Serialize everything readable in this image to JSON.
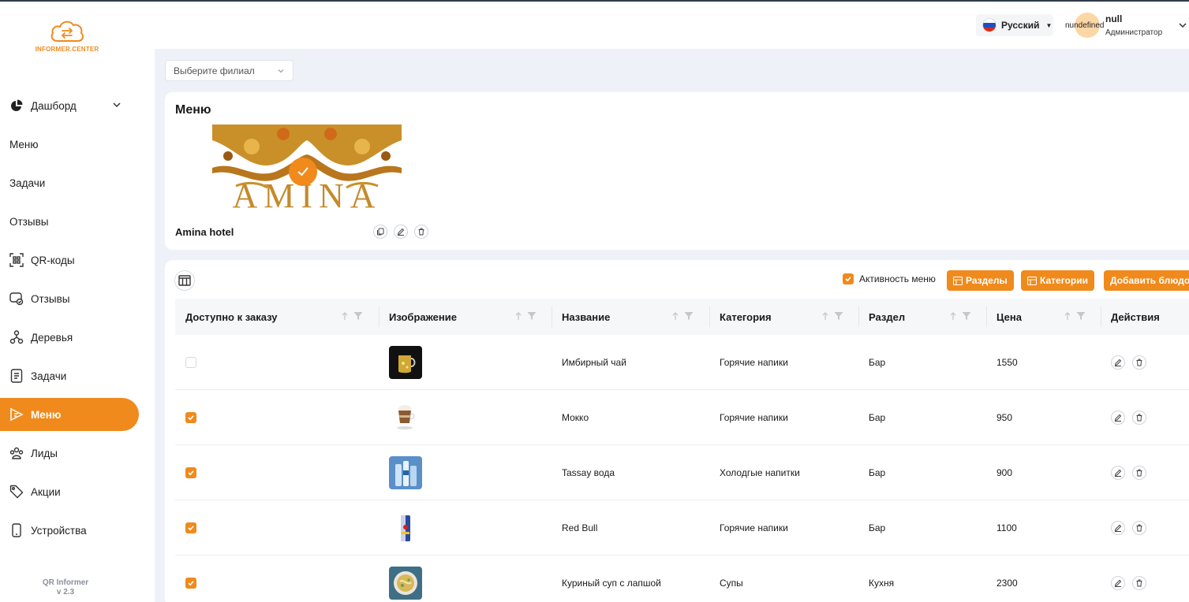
{
  "brand": {
    "logo_text": "INFORMER.CENTER",
    "app_name": "QR Informer",
    "version": "v 2.3",
    "accent": "#f08a1c"
  },
  "sidebar": {
    "items": [
      {
        "label": "Дашборд",
        "icon": "pie-chart-icon",
        "expandable": true
      },
      {
        "label": "Меню",
        "icon": ""
      },
      {
        "label": "Задачи",
        "icon": ""
      },
      {
        "label": "Отзывы",
        "icon": ""
      },
      {
        "label": "QR-коды",
        "icon": "qr-scan-icon"
      },
      {
        "label": "Отзывы",
        "icon": "feedback-icon"
      },
      {
        "label": "Деревья",
        "icon": "tree-icon"
      },
      {
        "label": "Задачи",
        "icon": "tasks-icon"
      },
      {
        "label": "Меню",
        "icon": "menu-icon",
        "active": true
      },
      {
        "label": "Лиды",
        "icon": "leads-icon"
      },
      {
        "label": "Акции",
        "icon": "tag-icon"
      },
      {
        "label": "Устройства",
        "icon": "device-icon"
      }
    ]
  },
  "header": {
    "language": "Русский",
    "user": {
      "avatar_text": "nundefined",
      "name": "null",
      "role": "Администратор"
    }
  },
  "branch_select": {
    "placeholder": "Выберите филиал"
  },
  "menu_card": {
    "title": "Меню",
    "image_text": "AMINA",
    "item_name": "Amina hotel"
  },
  "table_toolbar": {
    "activity_label": "Активность меню",
    "activity_checked": true,
    "sections_button": "Разделы",
    "categories_button": "Категории",
    "add_dish_button": "Добавить блюдо"
  },
  "table": {
    "columns": [
      "Доступно к заказу",
      "Изображение",
      "Название",
      "Категория",
      "Раздел",
      "Цена",
      "Действия"
    ],
    "rows": [
      {
        "available": false,
        "image": "ginger-tea-image",
        "name": "Имбирный чай",
        "category": "Горячие напики",
        "section": "Бар",
        "price": "1550"
      },
      {
        "available": true,
        "image": "mocha-image",
        "name": "Мокко",
        "category": "Горячие напики",
        "section": "Бар",
        "price": "950"
      },
      {
        "available": true,
        "image": "water-image",
        "name": "Tassay вода",
        "category": "Холодгые напитки",
        "section": "Бар",
        "price": "900"
      },
      {
        "available": true,
        "image": "redbull-image",
        "name": "Red Bull",
        "category": "Горячие напики",
        "section": "Бар",
        "price": "1100"
      },
      {
        "available": true,
        "image": "soup-image",
        "name": "Куриный суп с лапшой",
        "category": "Супы",
        "section": "Кухня",
        "price": "2300"
      }
    ]
  }
}
